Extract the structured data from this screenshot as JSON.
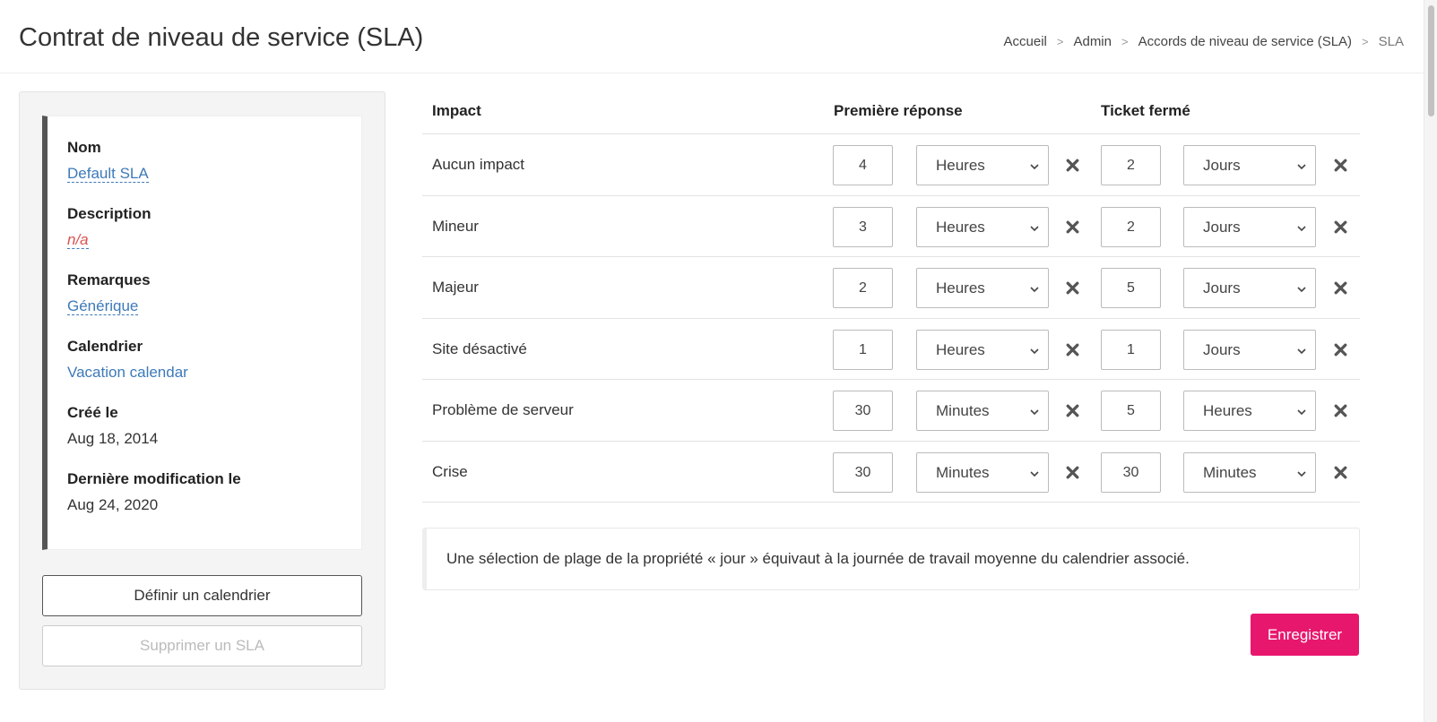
{
  "header": {
    "title": "Contrat de niveau de service (SLA)",
    "breadcrumb": [
      "Accueil",
      "Admin",
      "Accords de niveau de service (SLA)",
      "SLA"
    ],
    "breadcrumb_sep": ">"
  },
  "info": {
    "name_label": "Nom",
    "name_value": "Default SLA",
    "description_label": "Description",
    "description_value": "n/a",
    "remarks_label": "Remarques",
    "remarks_value": "Générique",
    "calendar_label": "Calendrier",
    "calendar_value": "Vacation calendar",
    "created_label": "Créé le",
    "created_value": "Aug 18, 2014",
    "modified_label": "Dernière modification le",
    "modified_value": "Aug 24, 2020"
  },
  "actions": {
    "define_calendar": "Définir un calendrier",
    "delete_sla": "Supprimer un SLA"
  },
  "table": {
    "col_impact": "Impact",
    "col_first_response": "Première réponse",
    "col_ticket_closed": "Ticket fermé",
    "rows": [
      {
        "impact": "Aucun impact",
        "fr_value": "4",
        "fr_unit": "Heures",
        "tc_value": "2",
        "tc_unit": "Jours"
      },
      {
        "impact": "Mineur",
        "fr_value": "3",
        "fr_unit": "Heures",
        "tc_value": "2",
        "tc_unit": "Jours"
      },
      {
        "impact": "Majeur",
        "fr_value": "2",
        "fr_unit": "Heures",
        "tc_value": "5",
        "tc_unit": "Jours"
      },
      {
        "impact": "Site désactivé",
        "fr_value": "1",
        "fr_unit": "Heures",
        "tc_value": "1",
        "tc_unit": "Jours"
      },
      {
        "impact": "Problème de serveur",
        "fr_value": "30",
        "fr_unit": "Minutes",
        "tc_value": "5",
        "tc_unit": "Heures"
      },
      {
        "impact": "Crise",
        "fr_value": "30",
        "fr_unit": "Minutes",
        "tc_value": "30",
        "tc_unit": "Minutes"
      }
    ]
  },
  "note": "Une sélection de plage de la propriété « jour » équivaut à la journée de travail moyenne du calendrier associé.",
  "save_label": "Enregistrer",
  "colors": {
    "accent": "#e8176e",
    "link": "#3d7ab8",
    "na": "#d9534f"
  }
}
